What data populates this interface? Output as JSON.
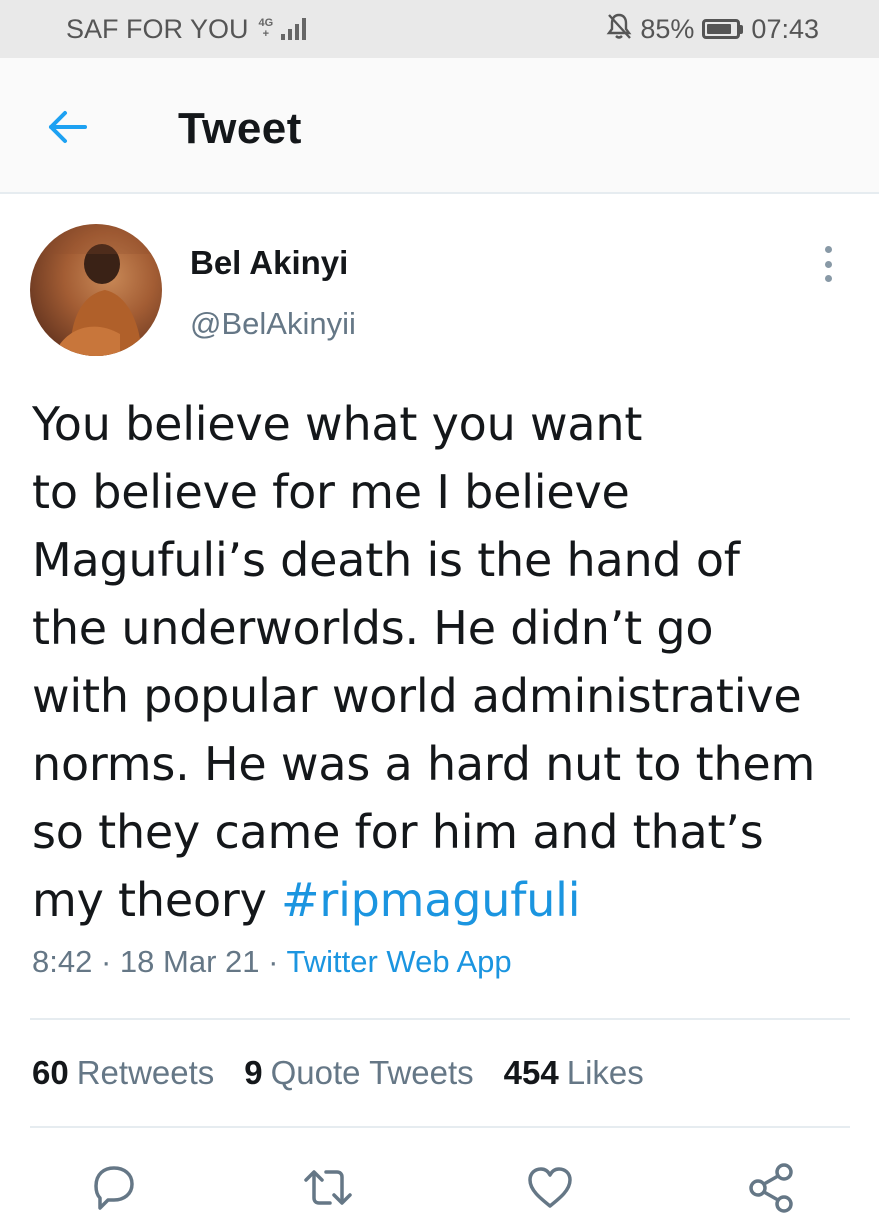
{
  "status_bar": {
    "carrier": "SAF FOR YOU",
    "network_top": "4G",
    "network_bottom": "+",
    "battery_percent": "85%",
    "battery_level": 0.85,
    "time": "07:43",
    "icons": [
      "signal-icon",
      "mute-alarm-icon",
      "battery-icon"
    ]
  },
  "header": {
    "title": "Tweet",
    "back_icon": "arrow-left-icon",
    "accent_color": "#1da1f2"
  },
  "tweet": {
    "author_name": "Bel Akinyi",
    "author_handle": "@BelAkinyii",
    "text_lines": [
      "You believe what you want",
      "to believe for me I believe",
      "Magufuli’s death is the hand of",
      "the underworlds. He didn’t go",
      "with popular world administrative",
      "norms. He was a hard nut to them",
      "so they came for him and that’s",
      "my theory "
    ],
    "hashtag": "#ripmagufuli",
    "time": "8:42",
    "date": "18 Mar 21",
    "separator": "·",
    "source": "Twitter Web App",
    "link_color": "#1b95e0"
  },
  "stats": {
    "retweets_count": "60",
    "retweets_label": "Retweets",
    "quotes_count": "9",
    "quotes_label": "Quote Tweets",
    "likes_count": "454",
    "likes_label": "Likes"
  },
  "actions": [
    "reply-icon",
    "retweet-icon",
    "like-icon",
    "share-icon"
  ]
}
